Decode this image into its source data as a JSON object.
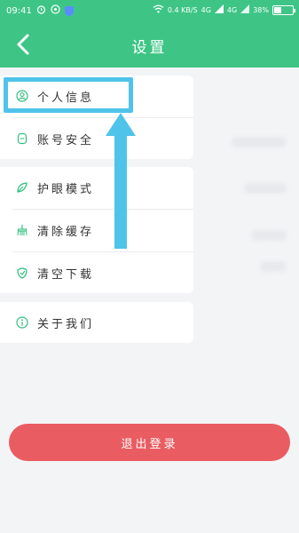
{
  "status_bar": {
    "time": "09:41",
    "network_speed": "0.4 KB/S",
    "signal_4g_a": "4G",
    "signal_4g_b": "4G",
    "battery_percent": "38%",
    "battery_level": 0.38
  },
  "header": {
    "title": "设置",
    "back_icon": "chevron-left-icon"
  },
  "settings": {
    "items": [
      {
        "label": "个人信息",
        "icon": "user-circle-icon"
      },
      {
        "label": "账号安全",
        "icon": "shield-icon"
      },
      {
        "label": "护眼模式",
        "icon": "eye-leaf-icon"
      },
      {
        "label": "清除缓存",
        "icon": "broom-icon"
      },
      {
        "label": "清空下载",
        "icon": "download-clear-icon"
      },
      {
        "label": "关于我们",
        "icon": "info-icon"
      }
    ]
  },
  "actions": {
    "logout_label": "退出登录"
  },
  "colors": {
    "brand_green": "#3ec585",
    "logout_red": "#e95c61",
    "annotation_blue": "#4fc3ea"
  }
}
